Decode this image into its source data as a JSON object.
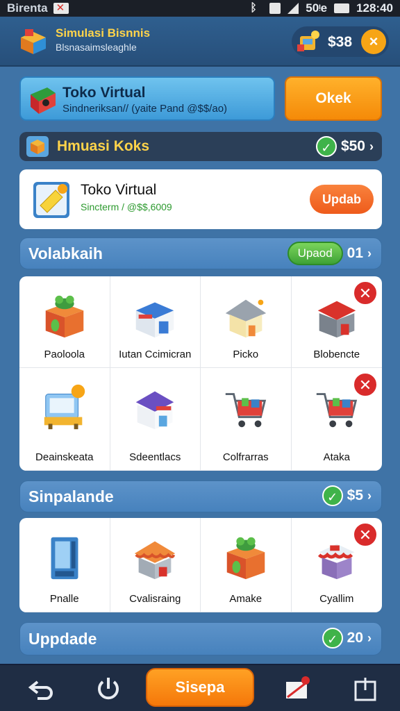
{
  "statusbar": {
    "carrier": "Birenta",
    "network": "50ᵎe",
    "time": "128:40"
  },
  "header": {
    "title": "Simulasi Bisnnis",
    "subtitle": "Blsnasaimsleaghle",
    "balance": "$38",
    "close_icon": "×"
  },
  "banner": {
    "title": "Toko Virtual",
    "subtitle": "Sindneriksan// (yaite Pand @$$/ao)",
    "button": "Okek"
  },
  "hm_bar": {
    "title": "Hmuasi Koks",
    "amount": "$50",
    "check": "✓",
    "chevron": "›"
  },
  "toko_card": {
    "title": "Toko Virtual",
    "subtitle": "Sincterm / @$$,6009",
    "button": "Updab"
  },
  "section1": {
    "title": "Volabkaih",
    "pill": "Upaod",
    "count": "01",
    "chevron": "›"
  },
  "grid1": [
    {
      "label": "Paoloola",
      "icon": "plant-box-icon",
      "close": false
    },
    {
      "label": "Iutan Ccimicran",
      "icon": "shop-icon",
      "close": false
    },
    {
      "label": "Picko",
      "icon": "house-icon",
      "close": false
    },
    {
      "label": "Blobencte",
      "icon": "red-store-icon",
      "close": true
    },
    {
      "label": "Deainskeata",
      "icon": "register-icon",
      "close": false
    },
    {
      "label": "Sdeentlacs",
      "icon": "storefront-icon",
      "close": false
    },
    {
      "label": "Colfrarras",
      "icon": "cart-icon",
      "close": false
    },
    {
      "label": "Ataka",
      "icon": "cart-icon",
      "close": true
    }
  ],
  "section2": {
    "title": "Sinpalande",
    "amount": "$5",
    "check": "✓",
    "chevron": "›"
  },
  "grid2": [
    {
      "label": "Pnalle",
      "icon": "vending-icon",
      "close": false
    },
    {
      "label": "Cvalisraing",
      "icon": "orange-shop-icon",
      "close": false
    },
    {
      "label": "Amake",
      "icon": "plant-box-icon",
      "close": false
    },
    {
      "label": "Cyallim",
      "icon": "stall-icon",
      "close": true
    }
  ],
  "section3": {
    "title": "Uppdade",
    "amount": "20",
    "check": "✓",
    "chevron": "›"
  },
  "close_glyph": "✕",
  "bottom_nav": {
    "main_button": "Sisepa"
  },
  "colors": {
    "accent": "#f58a08",
    "bg": "#3f73a6",
    "green": "#3fb34a",
    "red": "#d92b2b"
  }
}
